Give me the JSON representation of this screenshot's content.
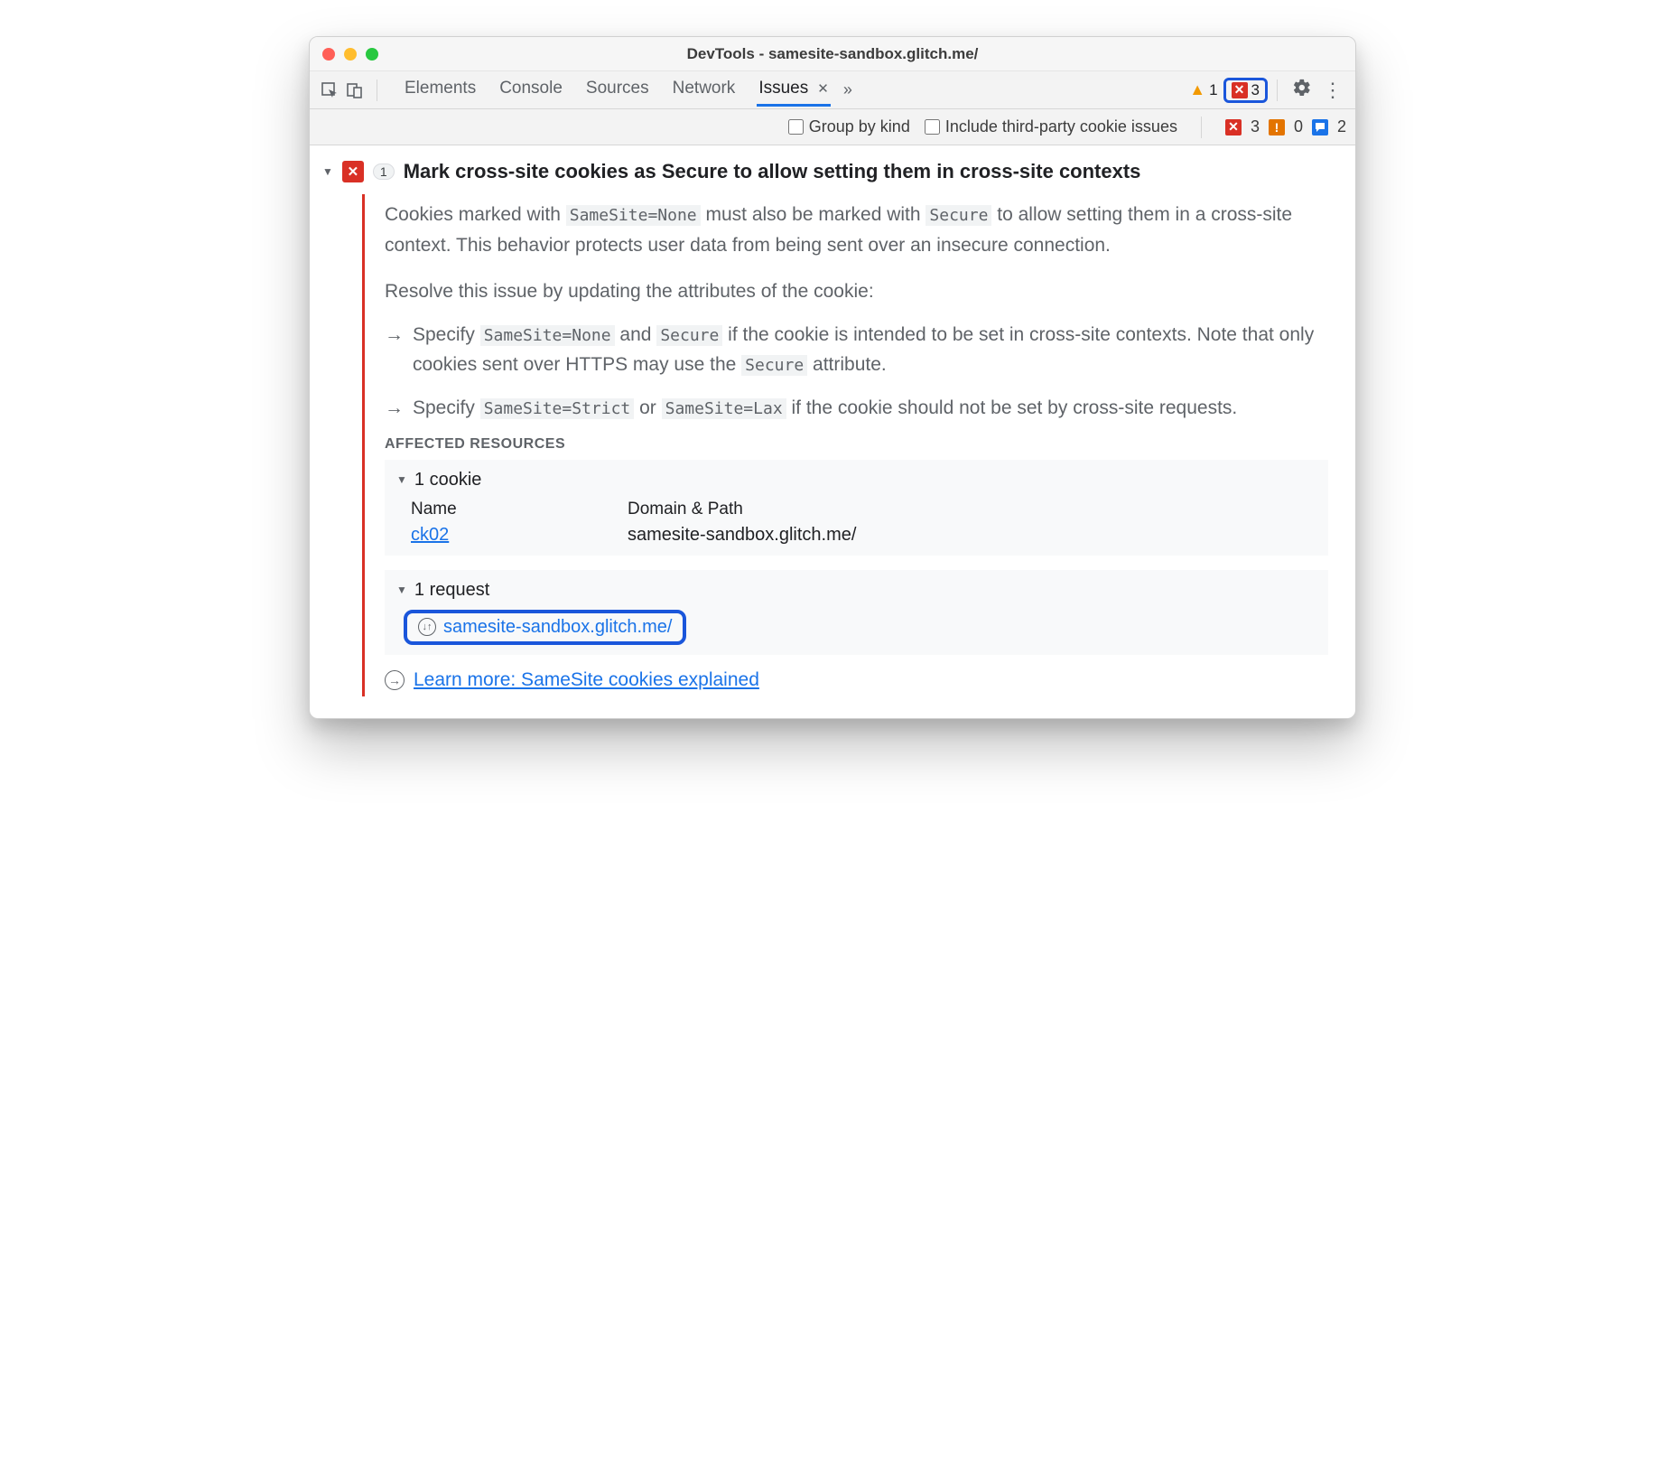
{
  "title": "DevTools - samesite-sandbox.glitch.me/",
  "tabs": [
    {
      "label": "Elements"
    },
    {
      "label": "Console"
    },
    {
      "label": "Sources"
    },
    {
      "label": "Network"
    },
    {
      "label": "Issues",
      "active": true
    }
  ],
  "topbar_badges": {
    "warn_count": "1",
    "error_count": "3"
  },
  "subbar": {
    "group_by_kind": "Group by kind",
    "include_thirdparty": "Include third-party cookie issues",
    "status": {
      "errors": "3",
      "warnings": "0",
      "info": "2"
    }
  },
  "issue": {
    "count": "1",
    "title": "Mark cross-site cookies as Secure to allow setting them in cross-site contexts",
    "p1_a": "Cookies marked with ",
    "p1_code1": "SameSite=None",
    "p1_b": " must also be marked with ",
    "p1_code2": "Secure",
    "p1_c": " to allow setting them in a cross-site context. This behavior protects user data from being sent over an insecure connection.",
    "resolve": "Resolve this issue by updating the attributes of the cookie:",
    "b1_a": "Specify ",
    "b1_code1": "SameSite=None",
    "b1_b": " and ",
    "b1_code2": "Secure",
    "b1_c": " if the cookie is intended to be set in cross-site contexts. Note that only cookies sent over HTTPS may use the ",
    "b1_code3": "Secure",
    "b1_d": " attribute.",
    "b2_a": "Specify ",
    "b2_code1": "SameSite=Strict",
    "b2_b": " or ",
    "b2_code2": "SameSite=Lax",
    "b2_c": " if the cookie should not be set by cross-site requests.",
    "affected_label": "AFFECTED RESOURCES",
    "cookie_section": "1 cookie",
    "cookie_headers": {
      "name": "Name",
      "domain": "Domain & Path"
    },
    "cookie_row": {
      "name": "ck02",
      "domain": "samesite-sandbox.glitch.me/"
    },
    "request_section": "1 request",
    "request_link": "samesite-sandbox.glitch.me/",
    "learn_more": "Learn more: SameSite cookies explained"
  }
}
